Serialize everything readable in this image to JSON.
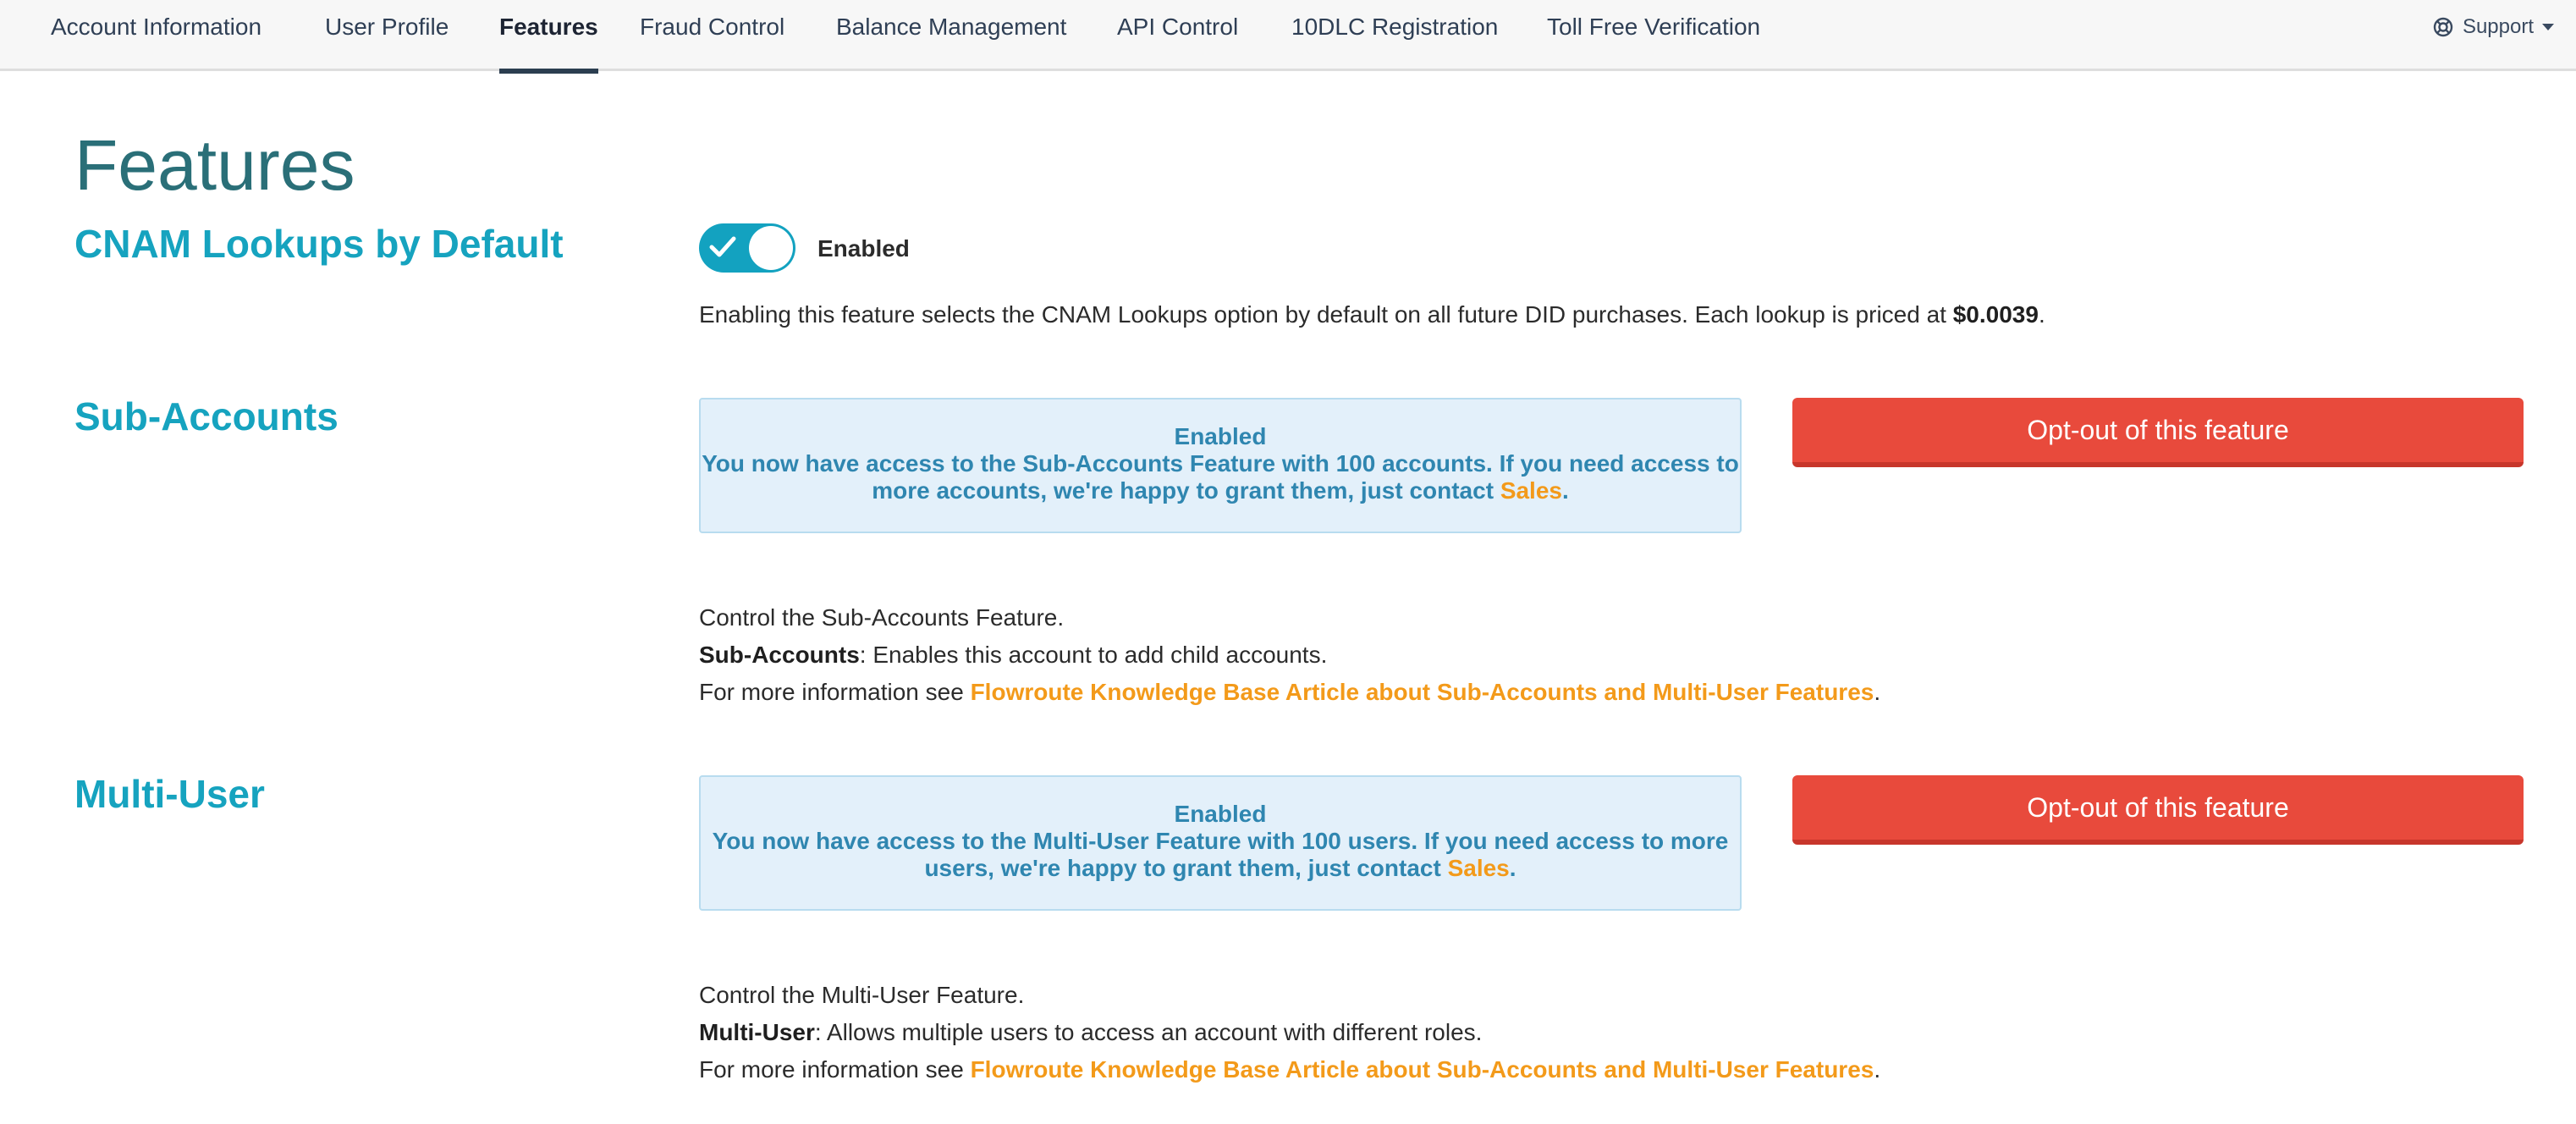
{
  "nav": {
    "tabs": [
      {
        "label": "Account Information",
        "active": false
      },
      {
        "label": "User Profile",
        "active": false
      },
      {
        "label": "Features",
        "active": true
      },
      {
        "label": "Fraud Control",
        "active": false
      },
      {
        "label": "Balance Management",
        "active": false
      },
      {
        "label": "API Control",
        "active": false
      },
      {
        "label": "10DLC Registration",
        "active": false
      },
      {
        "label": "Toll Free Verification",
        "active": false
      }
    ],
    "support": {
      "label": "Support",
      "icon": "lifebuoy-icon"
    }
  },
  "page": {
    "title": "Features"
  },
  "cnam": {
    "title": "CNAM Lookups by Default",
    "toggle_state": "on",
    "toggle_label": "Enabled",
    "description": "Enabling this feature selects the CNAM Lookups option by default on all future DID purchases. Each lookup is priced at ",
    "price": "$0.0039",
    "period": "."
  },
  "subaccounts": {
    "title": "Sub-Accounts",
    "box_title": "Enabled",
    "box_line1": "You now have access to the Sub-Accounts Feature with 100 accounts. If you need access to",
    "box_line2": "more accounts, we're happy to grant them, just contact ",
    "box_link": "Sales",
    "box_end": ".",
    "optout_label": "Opt-out of this feature",
    "control_text": "Control the Sub-Accounts Feature.",
    "feature_name": "Sub-Accounts",
    "feature_desc": ": Enables this account to add child accounts.",
    "more_info": "For more information see ",
    "kb_link": "Flowroute Knowledge Base Article about Sub-Accounts and Multi-User Features",
    "more_end": "."
  },
  "multiuser": {
    "title": "Multi-User",
    "box_title": "Enabled",
    "box_line1": "You now have access to the Multi-User Feature with 100 users. If you need access to more",
    "box_line2": "users, we're happy to grant them, just contact ",
    "box_link": "Sales",
    "box_end": ".",
    "optout_label": "Opt-out of this feature",
    "control_text": "Control the Multi-User Feature.",
    "feature_name": "Multi-User",
    "feature_desc": ": Allows multiple users to access an account with different roles.",
    "more_info": "For more information see ",
    "kb_link": "Flowroute Knowledge Base Article about Sub-Accounts and Multi-User Features",
    "more_end": "."
  },
  "colors": {
    "accent": "#16a3bf",
    "title": "#2a6f78",
    "danger": "#e84a3c",
    "link": "#f39a1a",
    "info_bg": "#e3f0fa",
    "info_text": "#2f86b0"
  }
}
